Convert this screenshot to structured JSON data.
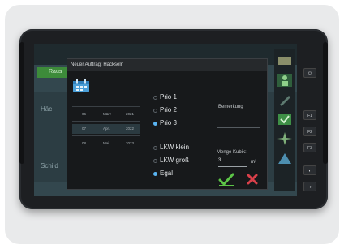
{
  "dialog": {
    "title": "Neuer Auftrag: Häckseln"
  },
  "background": {
    "green_tab": "Raus",
    "row1": "Häc",
    "row2": "Schild"
  },
  "dates": [
    [
      "06",
      "März",
      "2021"
    ],
    [
      "07",
      "Apr.",
      "2022"
    ],
    [
      "08",
      "Mai",
      "2023"
    ]
  ],
  "priority": {
    "options": [
      "Prio 1",
      "Prio 2",
      "Prio 3"
    ],
    "selected": "Prio 3"
  },
  "vehicle": {
    "options": [
      "LKW klein",
      "LKW groß",
      "Egal"
    ],
    "selected": "Egal"
  },
  "bemerkung": {
    "label": "Bemerkung",
    "value": ""
  },
  "menge": {
    "label": "Menge Kubik:",
    "value": "3",
    "unit": "m³"
  },
  "hardware_keys": [
    "F1",
    "F2",
    "F3"
  ],
  "colors": {
    "accent_blue": "#5ab4f2",
    "confirm_green": "#5cc447",
    "cancel_red": "#d9404a",
    "nav_green": "#3d8b3a"
  },
  "icons": {
    "calendar": "calendar-icon",
    "confirm": "checkmark-icon",
    "cancel": "cross-icon"
  }
}
